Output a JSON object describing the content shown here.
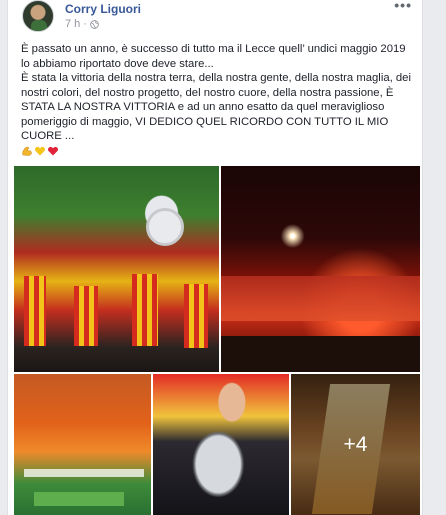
{
  "post": {
    "author": "Corry Liguori",
    "time": "7 h",
    "more_label": "•••",
    "icons": {
      "privacy": "globe-icon",
      "more": "more-options-icon",
      "emoji": [
        "flexed-biceps-icon",
        "yellow-heart-icon",
        "red-heart-icon"
      ]
    },
    "text_lines": [
      "È passato un anno, è successo di tutto ma il Lecce quell’ undici maggio 2019 lo abbiamo riportato dove deve stare...",
      "È stata la vittoria della nostra terra, della nostra gente, della nostra maglia, dei nostri colori, del nostro progetto, del nostro cuore, della nostra passione, È STATA LA NOSTRA VITTORIA e ad un anno esatto da quel meraviglioso pomeriggio di maggio, VI DEDICO QUEL RICORDO CON TUTTO IL MIO CUORE ..."
    ],
    "photos": {
      "more_count": "+4"
    }
  },
  "colors": {
    "author_link": "#385898",
    "meta_text": "#90949c",
    "text": "#1d2129",
    "page_bg": "#e9ebee"
  }
}
